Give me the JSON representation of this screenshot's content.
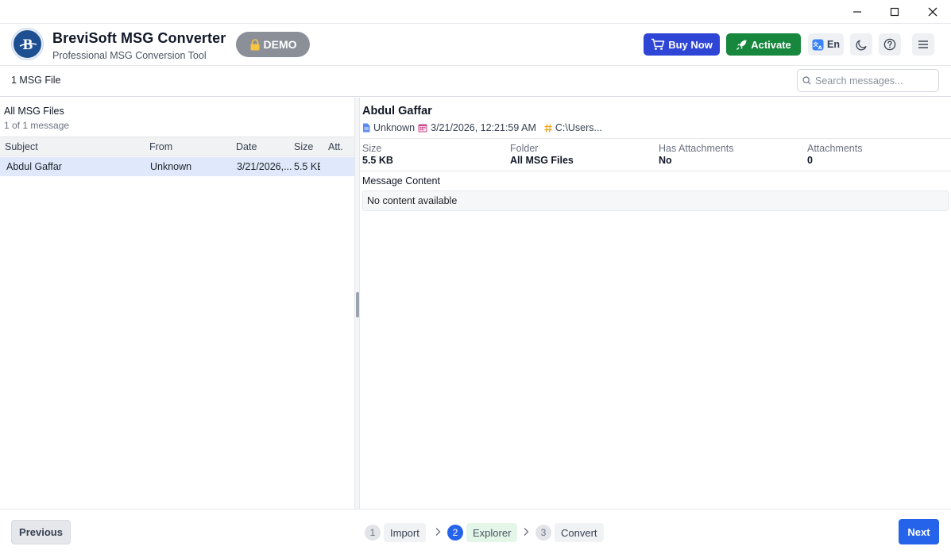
{
  "app": {
    "title": "BreviSoft MSG Converter",
    "subtitle": "Professional MSG Conversion Tool",
    "badge": "DEMO",
    "buy_label": "Buy Now",
    "activate_label": "Activate",
    "lang_label": "En"
  },
  "toolbar": {
    "file_count": "1 MSG File",
    "search_placeholder": "Search messages..."
  },
  "list": {
    "folder_title": "All MSG Files",
    "folder_count": "1 of 1 message",
    "columns": [
      "Subject",
      "From",
      "Date",
      "Size",
      "Att."
    ],
    "rows": [
      {
        "subject": "Abdul Gaffar",
        "from": "Unknown",
        "date": "3/21/2026,...",
        "size": "5.5 KB",
        "att": ""
      }
    ]
  },
  "detail": {
    "sender": "Abdul Gaffar",
    "from": "Unknown",
    "datetime": "3/21/2026, 12:21:59 AM",
    "path": "C:\\Users...",
    "props": [
      {
        "label": "Size",
        "value": "5.5 KB"
      },
      {
        "label": "Folder",
        "value": "All MSG Files"
      },
      {
        "label": "Has Attachments",
        "value": "No"
      },
      {
        "label": "Attachments",
        "value": "0"
      }
    ],
    "content_label": "Message Content",
    "content_text": "No content available"
  },
  "footer": {
    "prev_label": "Previous",
    "next_label": "Next",
    "steps": [
      {
        "num": "1",
        "label": "Import",
        "state": "done"
      },
      {
        "num": "2",
        "label": "Explorer",
        "state": "active"
      },
      {
        "num": "3",
        "label": "Convert",
        "state": "pending"
      }
    ]
  },
  "colors": {
    "primary": "#2563eb",
    "buy": "#2f45d6",
    "activate": "#16873d",
    "badge": "#8b9098",
    "selected_row": "#dfe9fb"
  }
}
